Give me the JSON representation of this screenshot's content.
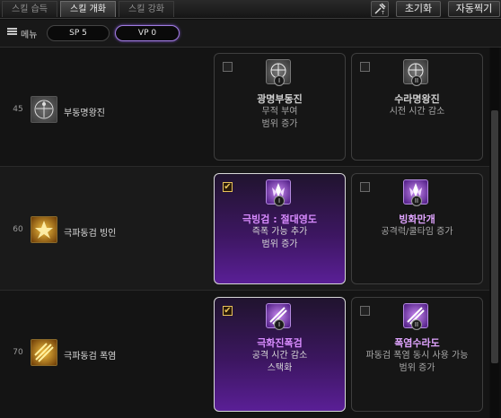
{
  "tabs": [
    {
      "label": "스킬 습득",
      "active": false
    },
    {
      "label": "스킬 개화",
      "active": true
    },
    {
      "label": "스킬 강화",
      "active": false
    }
  ],
  "toolbar": {
    "icon": "tool-icon",
    "reset_label": "초기화",
    "auto_label": "자동찍기"
  },
  "menu": {
    "label": "메뉴",
    "sp": "SP 5",
    "vp": "VP 0"
  },
  "rows": [
    {
      "level": "45",
      "skill_name": "부동명왕진",
      "icon": "vitruvian-icon",
      "cards": [
        {
          "name": "광명부동진",
          "desc": [
            "무적 부여",
            "범위 증가"
          ],
          "checked": false,
          "tier": "I"
        },
        {
          "name": "수라명왕진",
          "desc": [
            "시전 시간 감소"
          ],
          "checked": false,
          "tier": "II"
        }
      ]
    },
    {
      "level": "60",
      "skill_name": "극파동검 빙인",
      "icon": "ice-blade-icon",
      "cards": [
        {
          "name": "극빙검 : 절대영도",
          "desc": [
            "즉폭 가능 추가",
            "범위 증가"
          ],
          "checked": true,
          "tier": "I"
        },
        {
          "name": "빙화만개",
          "desc": [
            "공격력/쿨타임 증가"
          ],
          "checked": false,
          "tier": "II"
        }
      ]
    },
    {
      "level": "70",
      "skill_name": "극파동검 폭염",
      "icon": "flame-blade-icon",
      "cards": [
        {
          "name": "극화진폭검",
          "desc": [
            "공격 시간 감소",
            "스택화"
          ],
          "checked": true,
          "tier": "I"
        },
        {
          "name": "폭염수라도",
          "desc": [
            "파동검 폭염 동시 사용 가능",
            "범위 증가"
          ],
          "checked": false,
          "tier": "II"
        }
      ]
    }
  ]
}
